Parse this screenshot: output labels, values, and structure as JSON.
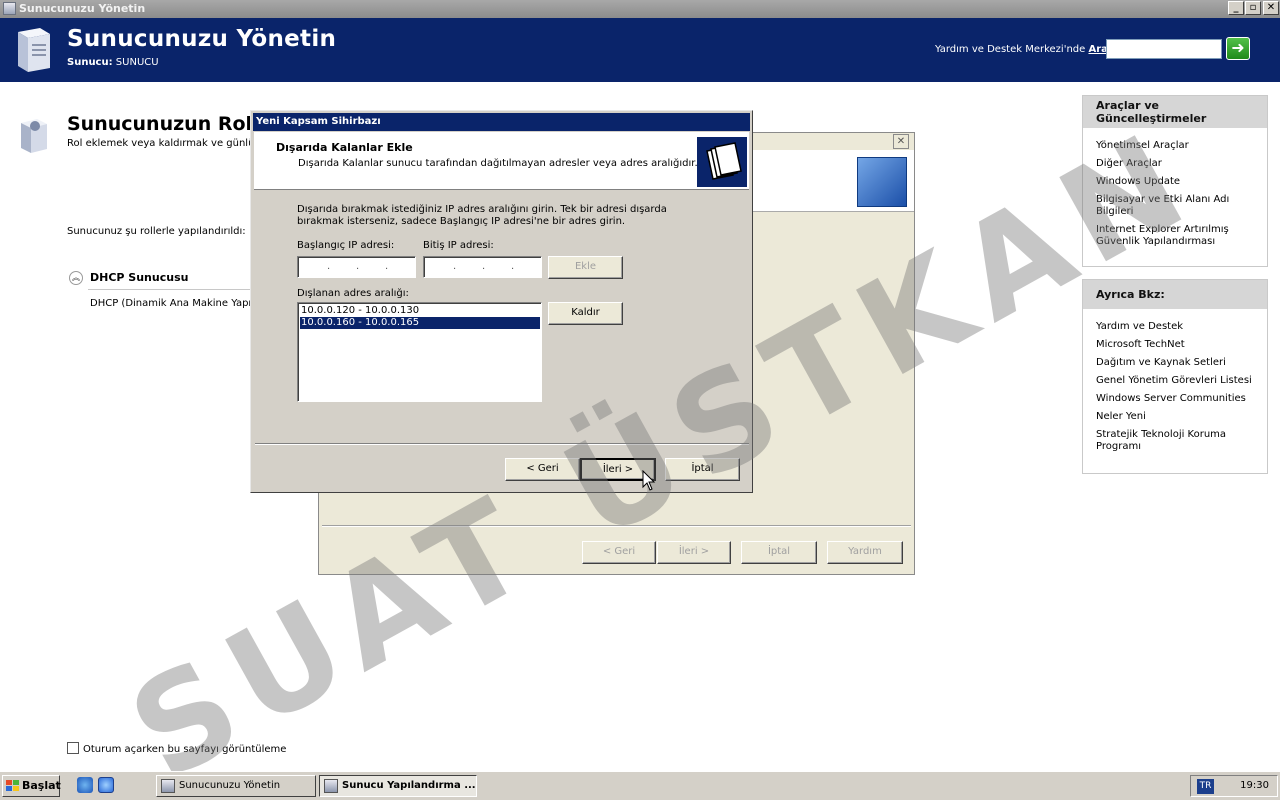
{
  "window": {
    "title": "Sunucunuzu Yönetin",
    "minimize": "_",
    "restore": "▫",
    "close": "✕"
  },
  "header": {
    "app_title": "Sunucunuzu Yönetin",
    "server_label": "Sunucu:",
    "server_name": "SUNUCU",
    "help_prefix": "Yardım ve Destek Merkezi'nde ",
    "help_search_word": "Ara",
    "search_value": "",
    "go_arrow": "➜"
  },
  "main": {
    "title": "Sunucunuzun Rolle",
    "subtitle": "Rol eklemek veya kaldırmak ve günlük",
    "roles_text": "Sunucunuz şu rollerle yapılandırıldı:",
    "role_chevron": "︽",
    "role_name": "DHCP Sunucusu",
    "role_desc": "DHCP (Dinamik Ana Makine Yapıla",
    "checkbox_label": "Oturum açarken bu sayfayı görüntüleme"
  },
  "panel_tools": {
    "title": "Araçlar ve Güncelleştirmeler",
    "items": [
      "Yönetimsel Araçlar",
      "Diğer Araçlar",
      "Windows Update",
      "Bilgisayar ve Etki Alanı Adı Bilgileri",
      "Internet Explorer Artırılmış Güvenlik Yapılandırması"
    ]
  },
  "panel_seealso": {
    "title": "Ayrıca Bkz:",
    "items": [
      "Yardım ve Destek",
      "Microsoft TechNet",
      "Dağıtım ve Kaynak Setleri",
      "Genel Yönetim Görevleri Listesi",
      "Windows Server Communities",
      "Neler Yeni",
      "Stratejik Teknoloji Koruma Programı"
    ]
  },
  "bg_wizard": {
    "close": "✕",
    "buttons": {
      "back": "< Geri",
      "next": "İleri >",
      "cancel": "İptal",
      "help": "Yardım"
    }
  },
  "dialog": {
    "title": "Yeni Kapsam Sihirbazı",
    "header_title": "Dışarıda Kalanlar Ekle",
    "header_sub": "Dışarıda Kalanlar sunucu tarafından dağıtılmayan adresler veya adres aralığıdır.",
    "instructions": "Dışarıda bırakmak istediğiniz IP adres aralığını girin. Tek bir adresi dışarda bırakmak isterseniz, sadece Başlangıç IP adresi'ne bir adres girin.",
    "start_ip_label": "Başlangıç IP adresi:",
    "end_ip_label": "Bitiş IP adresi:",
    "ip_dot": ".",
    "add_button": "Ekle",
    "excluded_label": "Dışlanan adres aralığı:",
    "excluded_ranges": [
      "10.0.0.120 - 10.0.0.130",
      "10.0.0.160 - 10.0.0.165"
    ],
    "remove_button": "Kaldır",
    "back_button": "< Geri",
    "next_button": "İleri >",
    "cancel_button": "İptal"
  },
  "watermark": "SUAT ÜSTKAN",
  "taskbar": {
    "start_label": "Başlat",
    "tasks": [
      "Sunucunuzu Yönetin",
      "Sunucu Yapılandırma ..."
    ],
    "language": "TR",
    "clock": "19:30"
  },
  "colors": {
    "header_blue": "#0a246a",
    "dialog_face": "#d4d0c8",
    "selection": "#0a246a"
  }
}
